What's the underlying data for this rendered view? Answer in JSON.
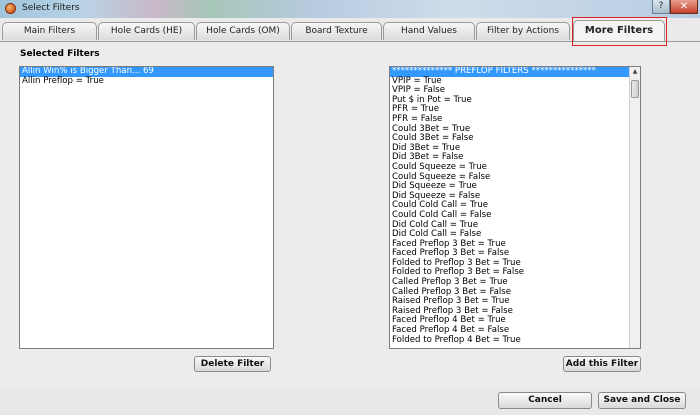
{
  "window": {
    "title": "Select Filters",
    "help_label": "?",
    "close_label": "✕"
  },
  "tabs": [
    "Main Filters",
    "Hole Cards (HE)",
    "Hole Cards (OM)",
    "Board Texture",
    "Hand Values",
    "Filter by Actions",
    "More Filters"
  ],
  "active_tab": "More Filters",
  "selected_filters": {
    "label": "Selected Filters",
    "items": [
      "Allin Win% is Bigger Than... 69",
      "Allin Preflop = True"
    ]
  },
  "available_filters": {
    "items": [
      "************** PREFLOP FILTERS ***************",
      "VPIP = True",
      "VPIP = False",
      "Put $ in Pot = True",
      "PFR = True",
      "PFR = False",
      "Could 3Bet = True",
      "Could 3Bet = False",
      "Did 3Bet = True",
      "Did 3Bet = False",
      "Could Squeeze = True",
      "Could Squeeze = False",
      "Did Squeeze = True",
      "Did Squeeze = False",
      "Could Cold Call = True",
      "Could Cold Call = False",
      "Did Cold Call = True",
      "Did Cold Call = False",
      "Faced Preflop 3 Bet = True",
      "Faced Preflop 3 Bet = False",
      "Folded to Preflop 3 Bet = True",
      "Folded to Preflop 3 Bet = False",
      "Called Preflop 3 Bet = True",
      "Called Preflop 3 Bet = False",
      "Raised Preflop 3 Bet = True",
      "Raised Preflop 3 Bet = False",
      "Faced Preflop 4 Bet = True",
      "Faced Preflop 4 Bet = False",
      "Folded to Preflop 4 Bet = True"
    ]
  },
  "buttons": {
    "delete": "Delete Filter",
    "add": "Add this Filter",
    "cancel": "Cancel",
    "save": "Save and Close"
  },
  "colors": {
    "selection": "#3399ff",
    "highlight_box": "#dd2222"
  }
}
